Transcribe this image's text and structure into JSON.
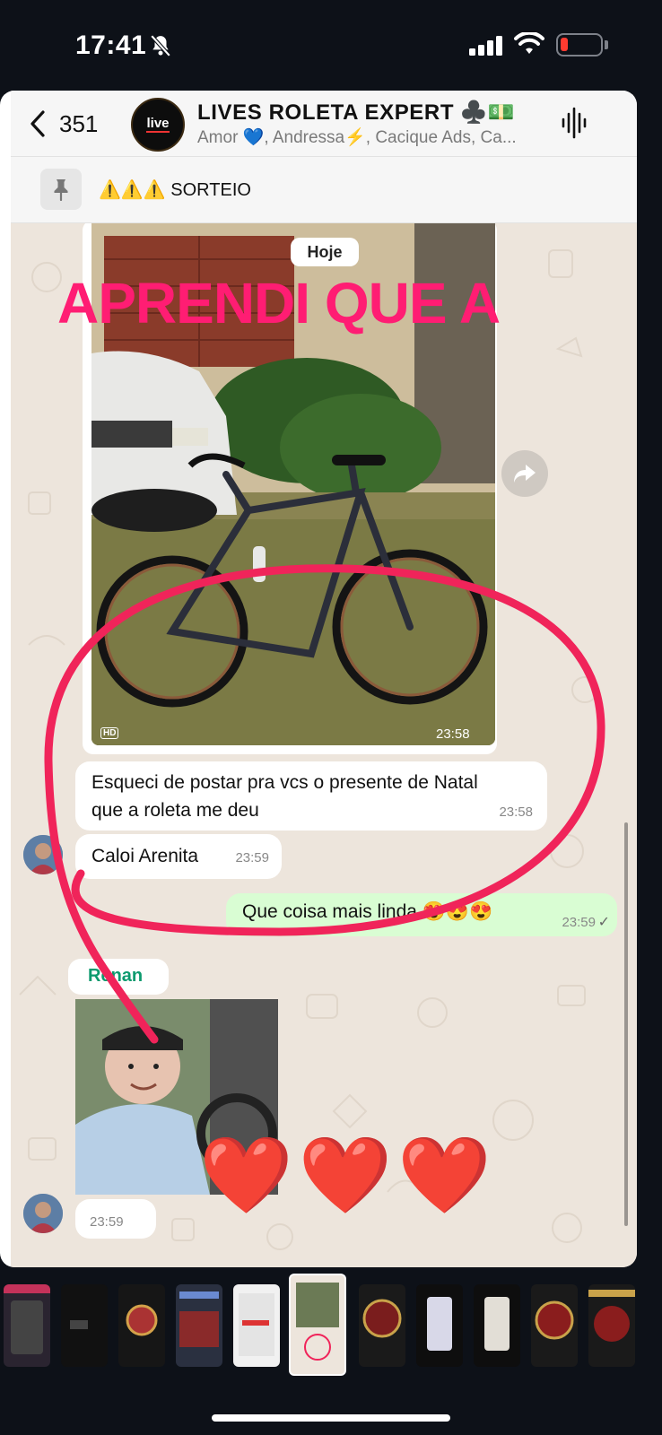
{
  "status_bar": {
    "time": "17:41",
    "bell_icon": "bell-slash-icon",
    "signal_icon": "cellular-signal-icon",
    "wifi_icon": "wifi-icon",
    "battery_icon": "battery-low-icon",
    "battery_color": "#ff3b30"
  },
  "chat_header": {
    "back_count": "351",
    "avatar_text": "live",
    "title": "LIVES ROLETA EXPERT ♣️💵",
    "members": "Amor 💙, Andressa⚡, Cacique Ads, Ca...",
    "audio_icon": "audio-wave-icon"
  },
  "pinned": {
    "warnings": "⚠️⚠️⚠️",
    "text": "SORTEIO"
  },
  "messages": {
    "date_label": "Hoje",
    "image_caption": "APRENDI QUE A",
    "image_hd": "HD",
    "image_time": "23:58",
    "msg1_text": "Esqueci de postar pra vcs o presente de Natal que a roleta me deu",
    "msg1_time": "23:58",
    "msg2_text": "Caloi Arenita",
    "msg2_time": "23:59",
    "out_text": "Que coisa mais linda 😍😍😍",
    "out_time": "23:59",
    "out_check": "✓",
    "sender_name": "Renan",
    "hearts": "❤️❤️❤️",
    "msg3_time": "23:59"
  },
  "colors": {
    "caption_pink": "#ff1d73",
    "annotation_red": "#f0245a",
    "sender_green": "#0c9a6e",
    "outgoing_bubble": "#d9fdd3",
    "chat_background": "#ede5dc"
  },
  "thumbnails": {
    "count": 11,
    "active_index": 5
  }
}
